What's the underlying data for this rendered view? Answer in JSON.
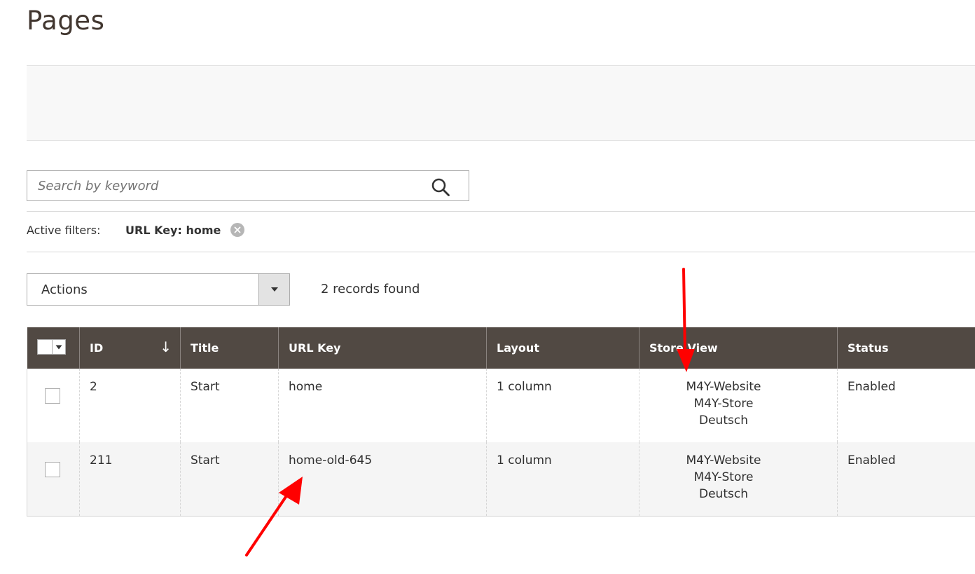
{
  "page": {
    "title": "Pages"
  },
  "search": {
    "placeholder": "Search by keyword",
    "value": ""
  },
  "filters": {
    "label": "Active filters:",
    "active": [
      {
        "label": "URL Key: home"
      }
    ]
  },
  "actions": {
    "label": "Actions"
  },
  "records": {
    "text": "2 records found"
  },
  "grid": {
    "columns": {
      "id": "ID",
      "title": "Title",
      "url_key": "URL Key",
      "layout": "Layout",
      "store_view": "Store View",
      "status": "Status"
    },
    "sort_indicator": "↓",
    "rows": [
      {
        "id": "2",
        "title": "Start",
        "url_key": "home",
        "layout": "1 column",
        "store_view": [
          "M4Y-Website",
          "M4Y-Store",
          "Deutsch"
        ],
        "status": "Enabled"
      },
      {
        "id": "211",
        "title": "Start",
        "url_key": "home-old-645",
        "layout": "1 column",
        "store_view": [
          "M4Y-Website",
          "M4Y-Store",
          "Deutsch"
        ],
        "status": "Enabled"
      }
    ]
  },
  "colors": {
    "header_bg": "#514943",
    "annotation_arrow": "#ff0000",
    "title_color": "#41362f"
  },
  "icons": {
    "search": "search-icon",
    "remove_filter": "close-circle-icon",
    "dropdown": "caret-down-icon",
    "annotation": "red-arrow-icon"
  }
}
